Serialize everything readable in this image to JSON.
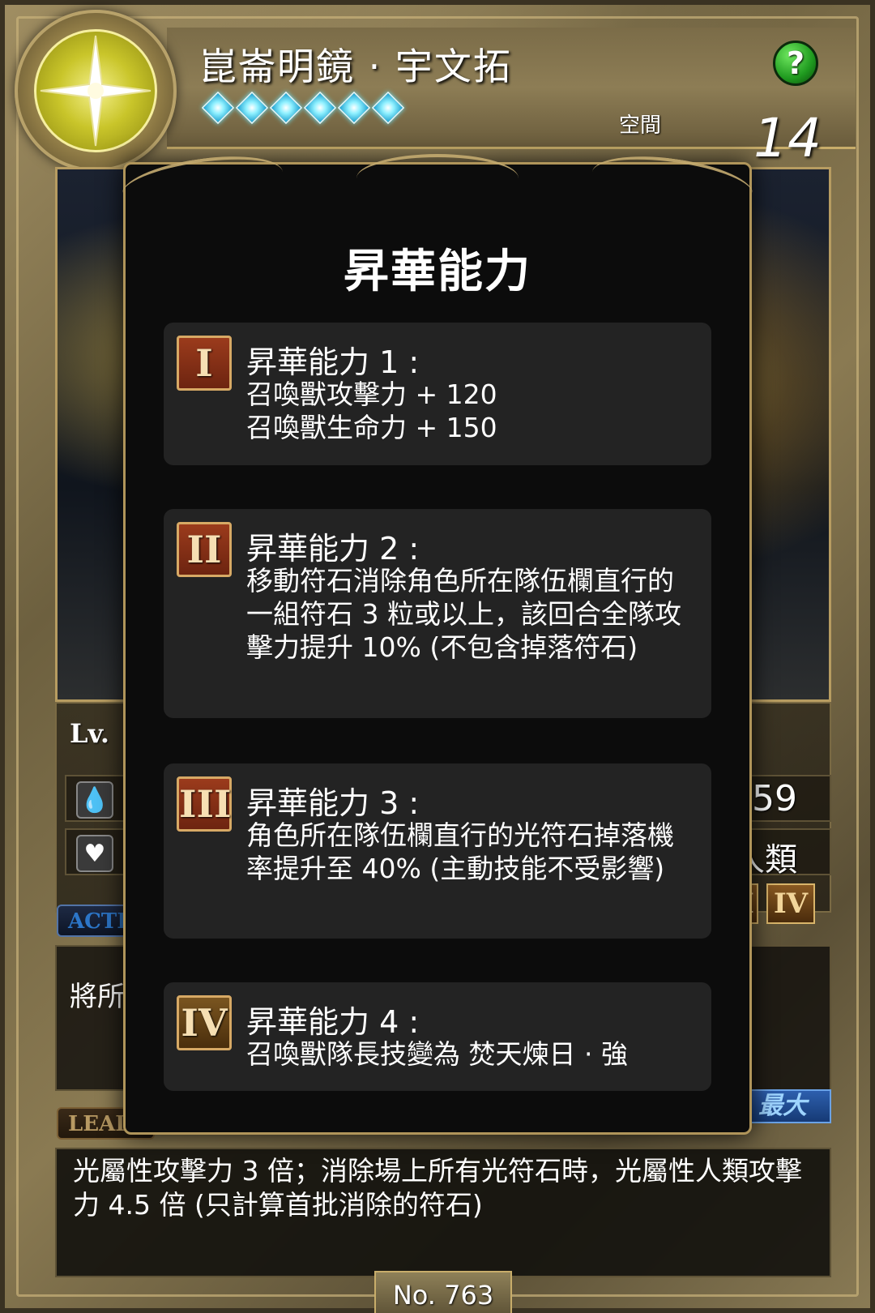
{
  "header": {
    "card_name": "崑崙明鏡 · 宇文拓",
    "star_count": 6,
    "space_label": "空間",
    "space_value": "14",
    "help_label": "?"
  },
  "info": {
    "lv_label": "Lv.",
    "stat_value": ".559",
    "race_value": "人類",
    "badge_partial": "I",
    "badge_iv": "IV",
    "active_tab": "ACTIV",
    "active_text": "將所",
    "leader_tab": "LEADI",
    "max_label": "最大",
    "leader_text": "光屬性攻擊力 3 倍；消除場上所有光符石時，光屬性人類攻擊力 4.5 倍 (只計算首批消除的符石)",
    "card_number": "No. 763"
  },
  "modal": {
    "title": "昇華能力",
    "abilities": [
      {
        "numeral": "I",
        "title": "昇華能力 1 :",
        "description": "召喚獸攻擊力 + 120\n召喚獸生命力 + 150"
      },
      {
        "numeral": "II",
        "title": "昇華能力 2 :",
        "description": "移動符石消除角色所在隊伍欄直行的一組符石 3 粒或以上，該回合全隊攻擊力提升 10% (不包含掉落符石)"
      },
      {
        "numeral": "III",
        "title": "昇華能力 3 :",
        "description": "角色所在隊伍欄直行的光符石掉落機率提升至 40% (主動技能不受影響)"
      },
      {
        "numeral": "IV",
        "title": "昇華能力 4 :",
        "description": "召喚獸隊長技變為 焚天煉日 · 強"
      }
    ]
  },
  "colors": {
    "frame_gold": "#c8ad6a",
    "modal_bg": "#0c0c0c",
    "ability_bg": "#232323",
    "badge_red": "#9b3b1c",
    "light_attr": "#f4f08a"
  }
}
